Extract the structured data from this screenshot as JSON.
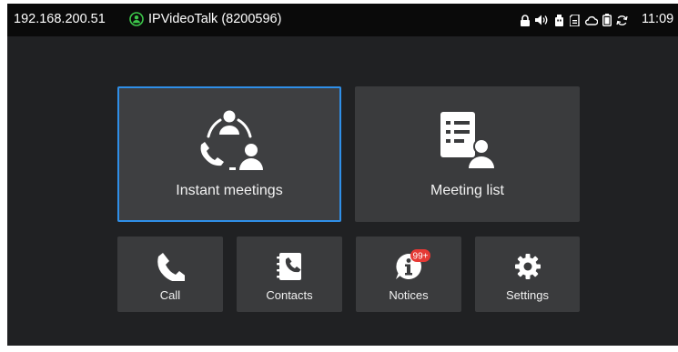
{
  "statusbar": {
    "ip_address": "192.168.200.51",
    "app_title": "IPVideoTalk (8200596)",
    "time": "11:09",
    "icons": [
      "lock-icon",
      "volume-icon",
      "usb-icon",
      "sd-card-icon",
      "cloud-icon",
      "battery-icon",
      "sync-icon"
    ]
  },
  "tiles": {
    "instant": {
      "label": "Instant meetings",
      "icon": "people-call-icon"
    },
    "meeting_list": {
      "label": "Meeting list",
      "icon": "meeting-list-icon"
    },
    "call": {
      "label": "Call",
      "icon": "phone-icon"
    },
    "contacts": {
      "label": "Contacts",
      "icon": "contacts-book-icon"
    },
    "notices": {
      "label": "Notices",
      "icon": "info-icon",
      "badge": "99+"
    },
    "settings": {
      "label": "Settings",
      "icon": "gear-icon"
    }
  },
  "colors": {
    "background": "#202123",
    "tile": "#3a3b3d",
    "focus_border": "#2f8fe8",
    "app_icon": "#3cc74a",
    "badge": "#e53935"
  }
}
